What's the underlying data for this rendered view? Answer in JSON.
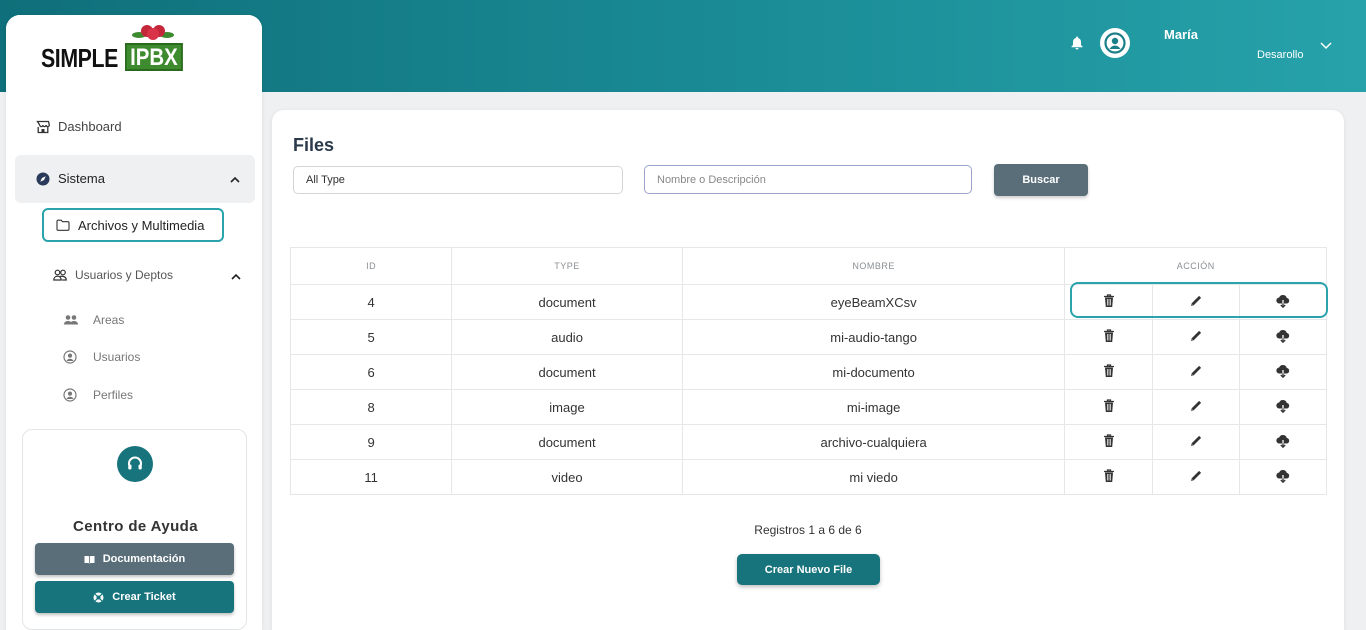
{
  "header": {
    "user_name": "María",
    "user_role": "Desarollo"
  },
  "logo": {
    "text_simple": "SIMPLE",
    "text_ipbx": "IPBX"
  },
  "sidebar": {
    "dashboard": "Dashboard",
    "sistema": "Sistema",
    "archivos": "Archivos y Multimedia",
    "usuarios_deptos": "Usuarios y Deptos",
    "areas": "Areas",
    "usuarios": "Usuarios",
    "perfiles": "Perfiles"
  },
  "help": {
    "title": "Centro de Ayuda",
    "doc_button": "Documentación",
    "ticket_button": "Crear Ticket"
  },
  "main": {
    "title": "Files",
    "type_select": "All Type",
    "search_placeholder": "Nombre o Descripción",
    "search_button": "Buscar",
    "columns": [
      "ID",
      "TYPE",
      "NOMBRE",
      "ACCIÓN"
    ],
    "rows": [
      {
        "id": "4",
        "type": "document",
        "nombre": "eyeBeamXCsv"
      },
      {
        "id": "5",
        "type": "audio",
        "nombre": "mi-audio-tango"
      },
      {
        "id": "6",
        "type": "document",
        "nombre": "mi-documento"
      },
      {
        "id": "8",
        "type": "image",
        "nombre": "mi-image"
      },
      {
        "id": "9",
        "type": "document",
        "nombre": "archivo-cualquiera"
      },
      {
        "id": "11",
        "type": "video",
        "nombre": "mi viedo"
      }
    ],
    "records": "Registros 1 a 6 de 6",
    "create_button": "Crear Nuevo File"
  },
  "colors": {
    "accent": "#17747c",
    "highlight": "#2aa3ad",
    "search_button": "#5a6e7a",
    "doc_button": "#5a6e7a"
  }
}
